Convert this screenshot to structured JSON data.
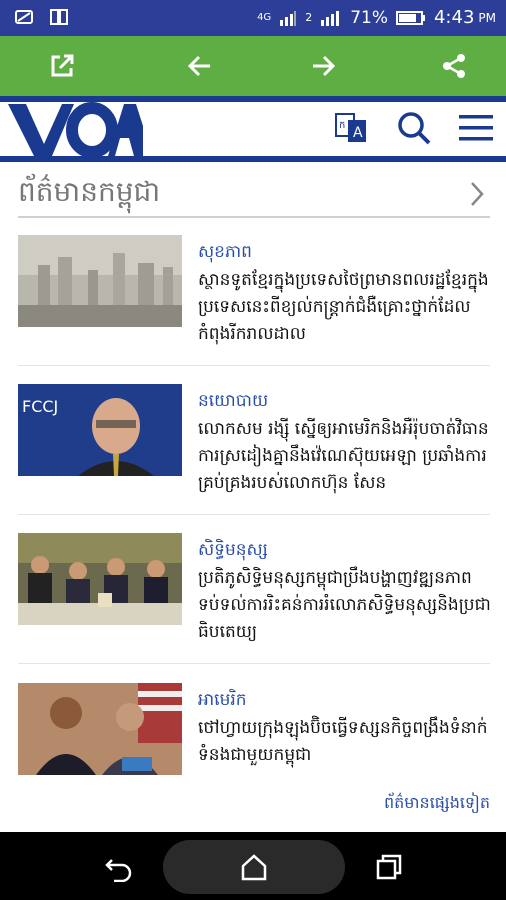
{
  "status_bar": {
    "battery": "71%",
    "time": "4:43",
    "ampm": "PM",
    "network": "4G",
    "sim1": "1",
    "sim2": "2"
  },
  "toolbar": {
    "icons": [
      "open-external-icon",
      "back-arrow-icon",
      "forward-arrow-icon",
      "share-icon"
    ]
  },
  "header": {
    "logo": "VOA",
    "icons": [
      "translate-icon",
      "search-icon",
      "menu-icon"
    ]
  },
  "section": {
    "title": "ព័ត៌មានកម្ពុជា"
  },
  "articles": [
    {
      "category": "សុខភាព",
      "headline": "ស្ថានទូតខ្មែរក្នុងប្រទេសថៃព្រមានពលរដ្ឋខ្មែរក្នុងប្រទេសនេះពីខ្យល់កន្ត្រាក់ជំងឺគ្រោះថ្នាក់ដែលកំពុងរីករាលដាល"
    },
    {
      "category": "នយោបាយ",
      "headline": "លោកសម រង្ស៊ី ស្នើឲ្យអាមេរិកនិងអឺរ៉ុបចាត់វិធានការស្រដៀងគ្នានឹងវ៉េណេស៊ុយអេឡា ប្រឆាំងការគ្រប់គ្រងរបស់លោកហ៊ុន សែន"
    },
    {
      "category": "សិទ្ធិមនុស្ស",
      "headline": "ប្រតិភូសិទ្ធិមនុស្សកម្ពុជាប្រឹងបង្ហាញវឌ្ឍនភាពទប់ទល់ការរិះគន់ការរំលោភសិទ្ធិមនុស្សនិងប្រជាធិបតេយ្យ"
    },
    {
      "category": "អាមេរិក",
      "headline": "ថៅហ្វាយក្រុងឡុងប៊ិចធ្វើទស្សនកិច្ចពង្រឹងទំនាក់ទំនងជាមួយកម្ពុជា"
    }
  ],
  "more_link": "ព័ត៌មានផ្សេងទៀត",
  "nav": {
    "icons": [
      "back-icon",
      "home-icon",
      "recents-icon"
    ]
  }
}
